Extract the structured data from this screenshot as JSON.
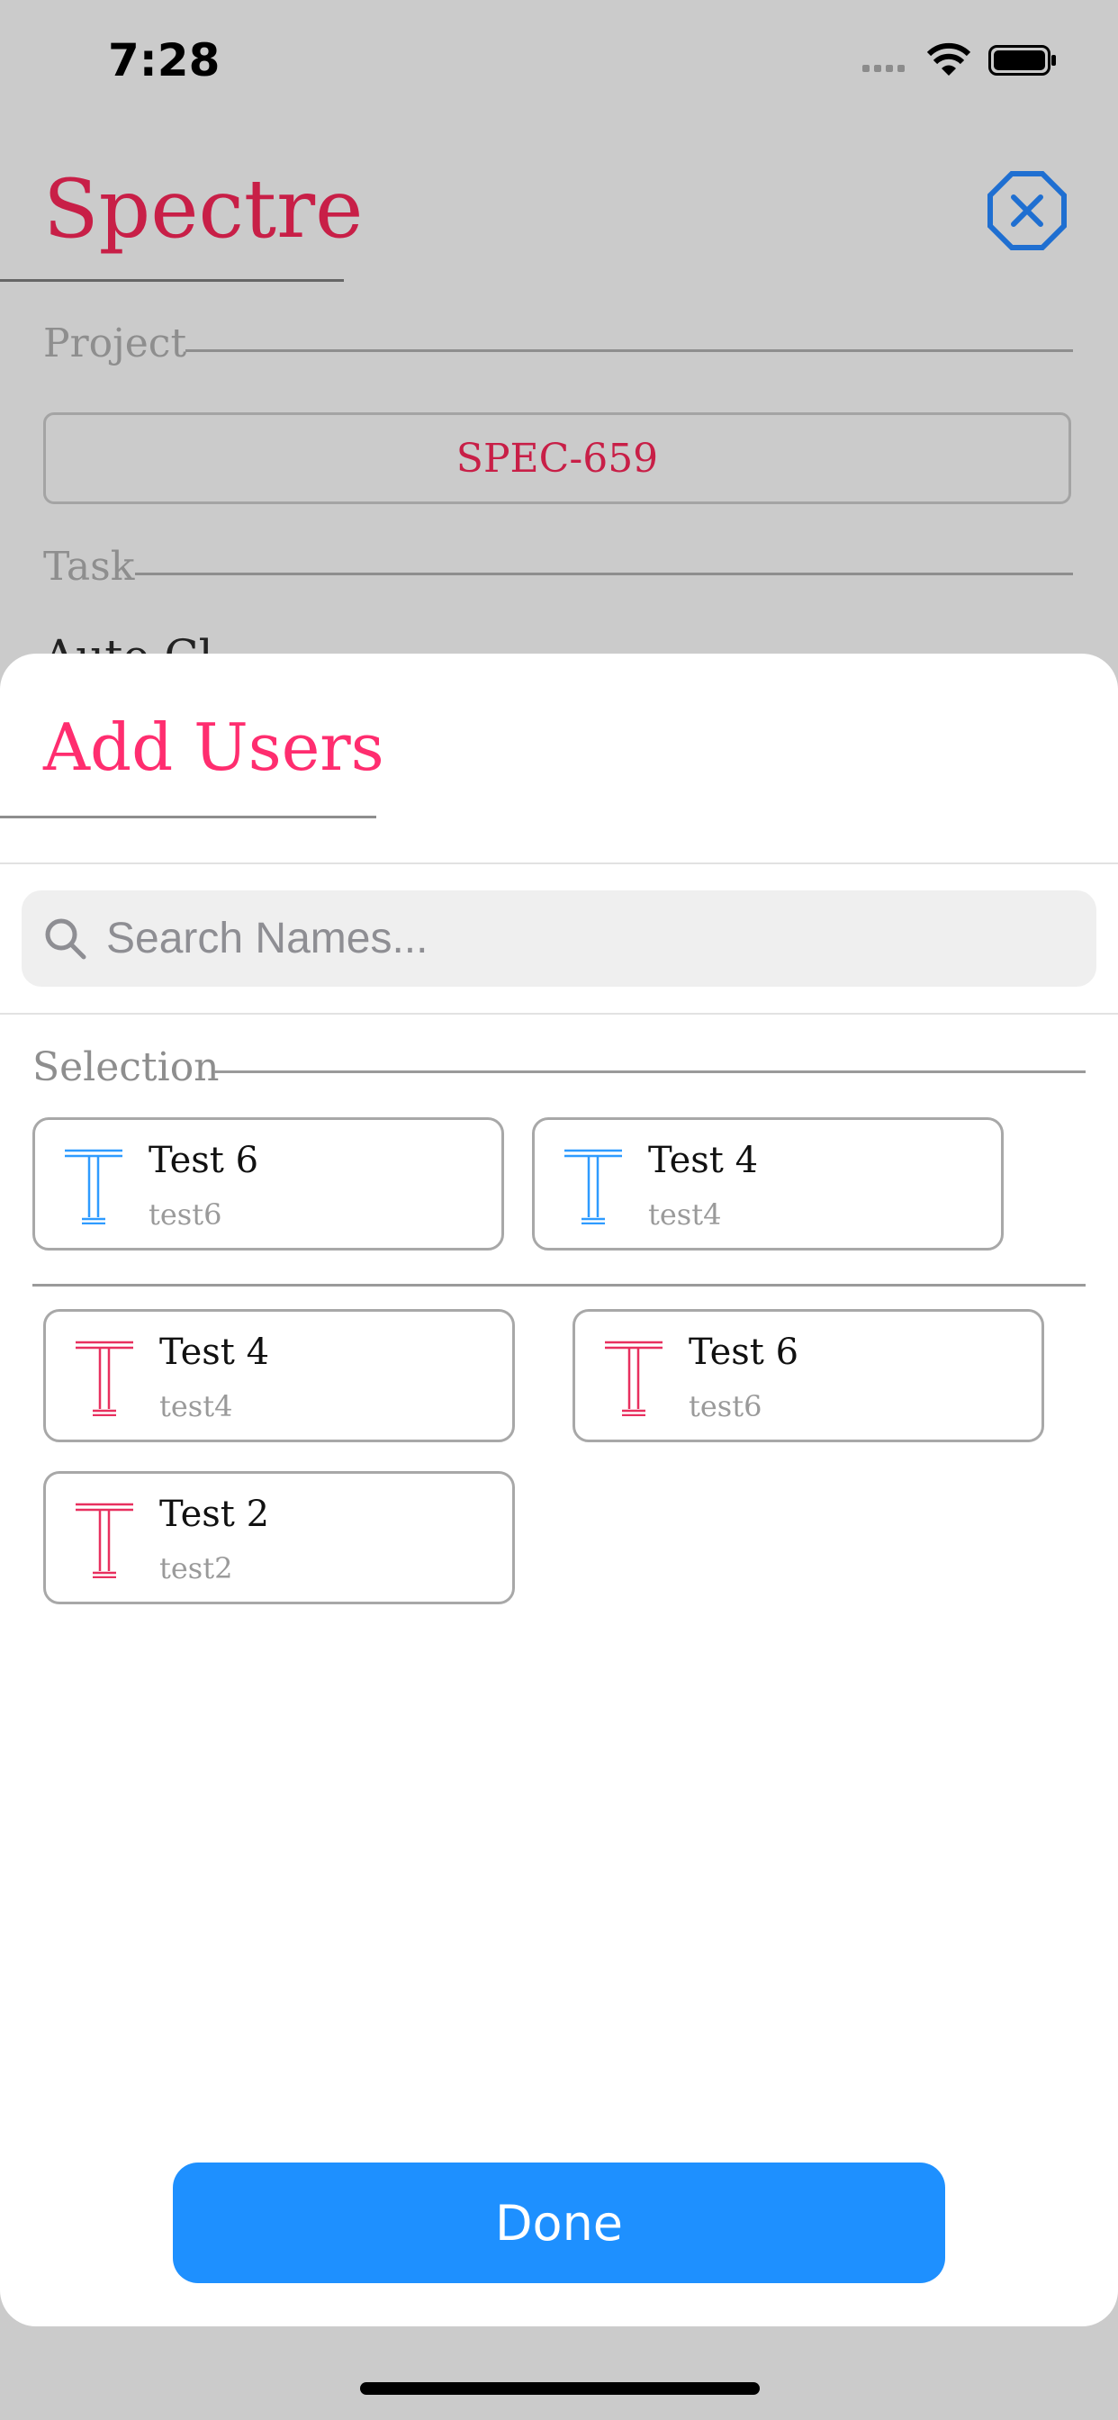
{
  "status_bar": {
    "time": "7:28"
  },
  "background": {
    "app_title": "Spectre",
    "project_label": "Project",
    "project_value": "SPEC-659",
    "task_label": "Task",
    "task_value_peek": "Auto Cl"
  },
  "sheet": {
    "title": "Add Users",
    "search": {
      "placeholder": "Search Names..."
    },
    "selection_label": "Selection",
    "selected": [
      {
        "name": "Test 6",
        "username": "test6",
        "initial": "T"
      },
      {
        "name": "Test 4",
        "username": "test4",
        "initial": "T"
      }
    ],
    "users": [
      {
        "name": "Test 4",
        "username": "test4",
        "initial": "T"
      },
      {
        "name": "Test 6",
        "username": "test6",
        "initial": "T"
      },
      {
        "name": "Test 2",
        "username": "test2",
        "initial": "T"
      }
    ],
    "done_label": "Done"
  },
  "colors": {
    "accent_red": "#c81f47",
    "sheet_title_pink": "#ff2d6f",
    "selected_blue": "#2e9bff",
    "done_blue": "#1e90ff"
  }
}
